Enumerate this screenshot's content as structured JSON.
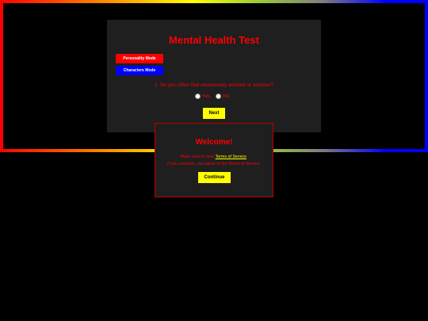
{
  "card": {
    "title": "Mental Health Test",
    "modes": {
      "personality_label": "Personality Mode",
      "characters_label": "Characters Mode"
    },
    "question": "1. Do you often feel excessively worried or anxious?",
    "answers": {
      "yes_label": "Yes",
      "no_label": "No"
    },
    "next_label": "Next"
  },
  "modal": {
    "title": "Welcome!",
    "line1_prefix": "Make sure to read ",
    "tos_link": "Terms of Service",
    "line1_suffix": ".",
    "line2": "If you continue, you agree to the Terms of Service.",
    "continue_label": "Continue"
  },
  "colors": {
    "accent_red": "#ff0000",
    "accent_blue": "#0000ff",
    "accent_yellow": "#ffff00",
    "card_bg": "#1f1f1f",
    "page_bg": "#000000"
  },
  "icons": {
    "radio_unselected": "radio-icon"
  }
}
